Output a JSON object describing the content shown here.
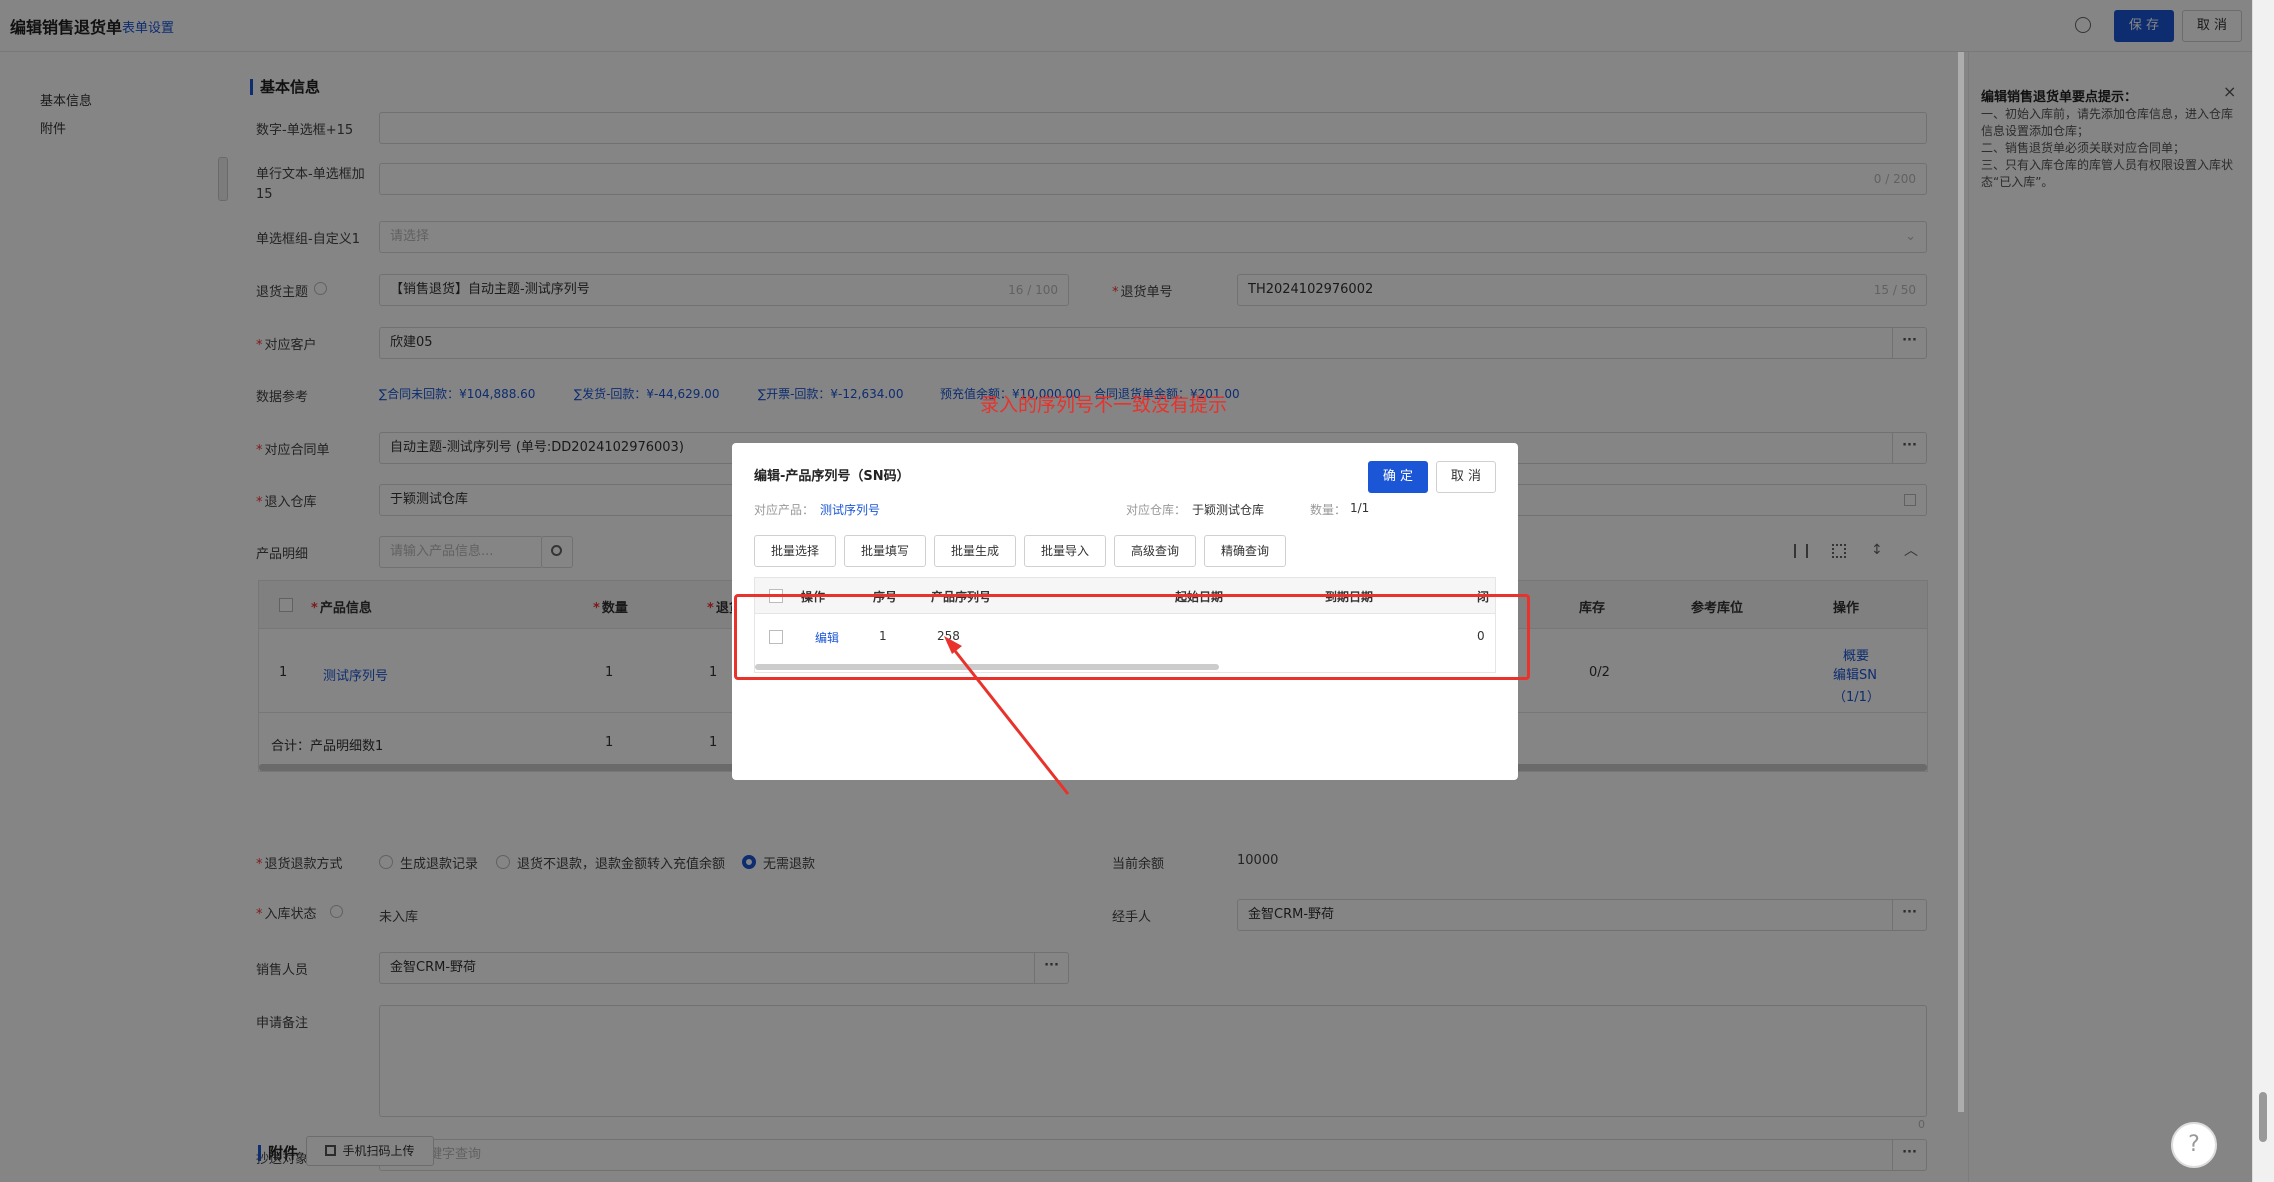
{
  "topbar": {
    "title": "编辑销售退货单",
    "form_settings": "表单设置",
    "save": "保 存",
    "cancel": "取 消"
  },
  "leftnav": {
    "items": [
      "基本信息",
      "附件"
    ]
  },
  "section_basic": "基本信息",
  "fields": {
    "f1_label": "数字-单选框+15",
    "f2_label": "单行文本-单选框加15",
    "f2_count": "0 / 200",
    "f3_label": "单选框组-自定义1",
    "f3_placeholder": "请选择",
    "subject_label": "退货主题",
    "subject_value": "【销售退货】自动主题-测试序列号",
    "subject_count": "16 / 100",
    "no_label": "退货单号",
    "no_value": "TH2024102976002",
    "no_count": "15 / 50",
    "customer_label": "对应客户",
    "customer_value": "欣建05",
    "ref_label": "数据参考",
    "ref_items": [
      "∑合同未回款：¥104,888.60",
      "∑发货-回款：¥-44,629.00",
      "∑开票-回款：¥-12,634.00",
      "预充值余额：¥10,000.00",
      "合同退货单金额：¥201.00"
    ],
    "contract_label": "对应合同单",
    "contract_value": "自动主题-测试序列号 (单号:DD2024102976003)",
    "warehouse_label": "退入仓库",
    "warehouse_value": "于颖测试仓库",
    "detail_label": "产品明细",
    "detail_placeholder": "请输入产品信息...",
    "refund_label": "退货退款方式",
    "refund_options": [
      "生成退款记录",
      "退货不退款，退款金额转入充值余额",
      "无需退款"
    ],
    "balance_label": "当前余额",
    "balance_value": "10000",
    "instock_label": "入库状态",
    "instock_value": "未入库",
    "handler_label": "经手人",
    "handler_value": "金智CRM-野荷",
    "sales_label": "销售人员",
    "sales_value": "金智CRM-野荷",
    "remark_label": "申请备注",
    "remark_count": "0",
    "cc_label": "抄送对象",
    "cc_placeholder": "输入关键字查询"
  },
  "main_table": {
    "headers": [
      "产品信息",
      "数量",
      "退货",
      "库存",
      "参考库位",
      "操作"
    ],
    "row": {
      "index": "1",
      "product": "测试序列号",
      "qty": "1",
      "ret": "1",
      "stock": "0/2",
      "op1": "概要",
      "op2": "编辑SN（1/1）"
    },
    "total": {
      "label": "合计：产品明细数1",
      "qty": "1",
      "ret": "1"
    }
  },
  "attachments": {
    "title": "附件",
    "upload": "手机扫码上传"
  },
  "rightpanel": {
    "title": "编辑销售退货单要点提示：",
    "lines": [
      "一、初始入库前，请先添加仓库信息，进入仓库信息设置添加仓库；",
      "二、销售退货单必须关联对应合同单；",
      "三、只有入库仓库的库管人员有权限设置入库状态“已入库”。"
    ]
  },
  "annotation": "录入的序列号不一致没有提示",
  "modal": {
    "title": "编辑-产品序列号（SN码）",
    "confirm": "确 定",
    "cancel": "取 消",
    "product_label": "对应产品：",
    "product_value": "测试序列号",
    "warehouse_label": "对应仓库：",
    "warehouse_value": "于颖测试仓库",
    "qty_label": "数量：",
    "qty_value": "1/1",
    "toolbar": [
      "批量选择",
      "批量填写",
      "批量生成",
      "批量导入",
      "高级查询",
      "精确查询"
    ],
    "headers": [
      "操作",
      "序号",
      "产品序列号",
      "起始日期",
      "到期日期",
      "闭"
    ],
    "row": {
      "op": "编辑",
      "index": "1",
      "sn": "258",
      "start": "",
      "end": "",
      "last": "0"
    }
  }
}
